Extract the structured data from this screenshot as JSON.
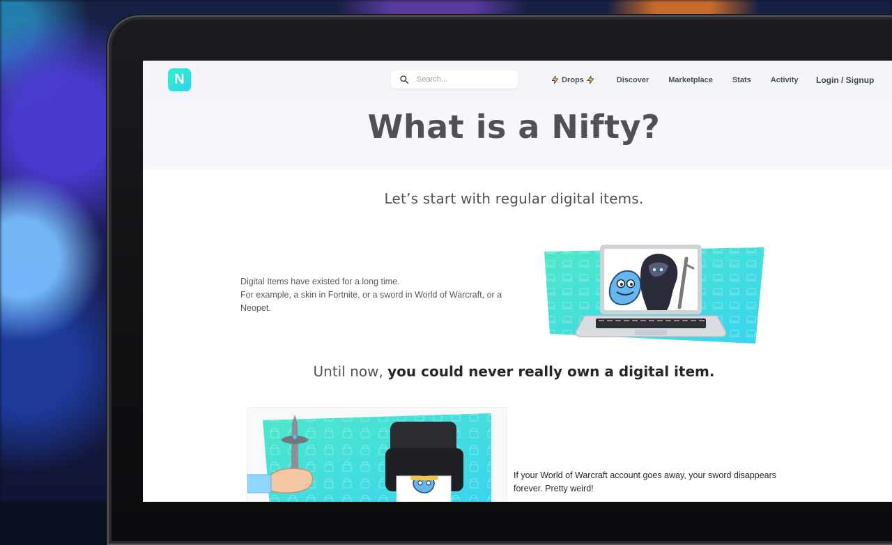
{
  "nav": {
    "logo_letter": "N",
    "search_placeholder": "Search...",
    "links": {
      "drops": "Drops",
      "discover": "Discover",
      "marketplace": "Marketplace",
      "stats": "Stats",
      "activity": "Activity"
    },
    "login": "Login / Signup"
  },
  "hero": {
    "title": "What is a Nifty?"
  },
  "section1": {
    "subtitle": "Let’s start with regular digital items.",
    "para_line1": "Digital Items have existed for a long time.",
    "para_line2": "For example, a skin in Fortnite, or a sword in World of Warcraft, or a Neopet."
  },
  "section2": {
    "headline_prefix": "Until now, ",
    "headline_bold": "you could never really own a digital item.",
    "para": "If your World of Warcraft account goes away, your sword disappears forever. Pretty weird!"
  },
  "colors": {
    "accent_gradient_start": "#34f2c9",
    "accent_gradient_end": "#2ad1f0",
    "nav_text": "#4b4f58",
    "title_text": "#4f5157"
  },
  "icons": {
    "search": "search-icon",
    "bolt": "lightning-bolt-icon"
  }
}
